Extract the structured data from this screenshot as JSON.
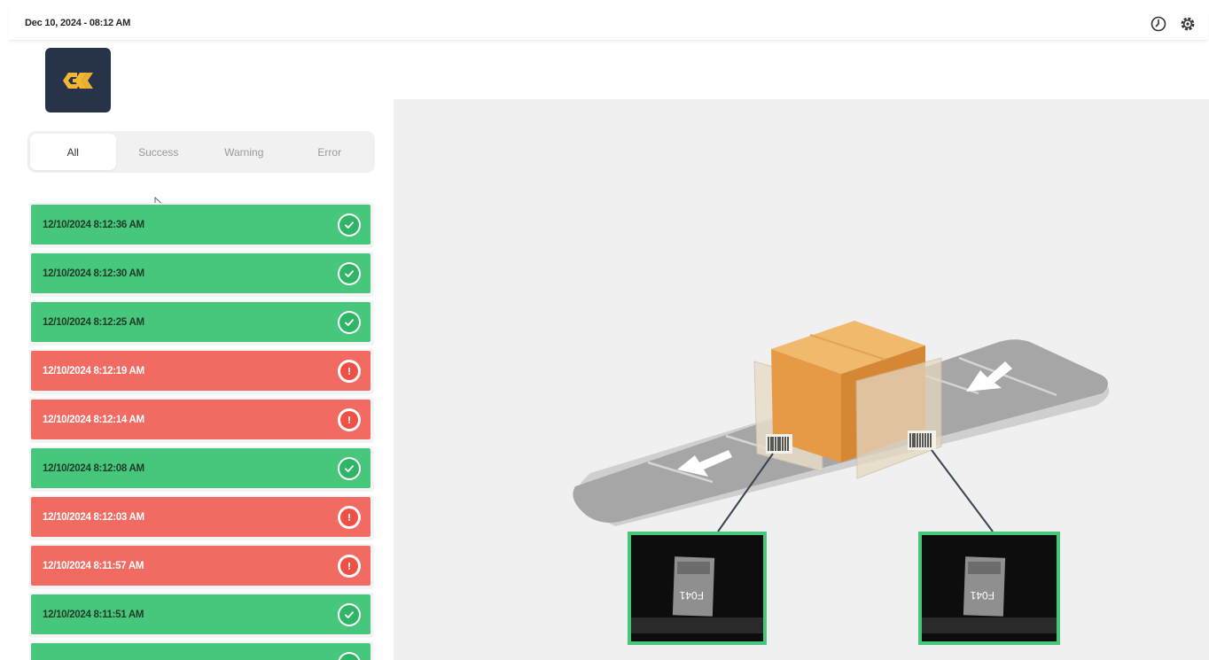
{
  "header": {
    "datetime": "Dec 10, 2024 - 08:12 AM",
    "icons": [
      "history-icon",
      "settings-icon"
    ]
  },
  "logo": {
    "text": "GK",
    "background": "#263349",
    "accent": "#f2b632"
  },
  "filters": {
    "tabs": [
      {
        "label": "All",
        "active": true
      },
      {
        "label": "Success",
        "active": false
      },
      {
        "label": "Warning",
        "active": false
      },
      {
        "label": "Error",
        "active": false
      }
    ]
  },
  "colors": {
    "success": "#46c77b",
    "error": "#f26b62"
  },
  "log": {
    "entries": [
      {
        "timestamp": "12/10/2024 8:12:36 AM",
        "status": "success",
        "icon": "check-circle-icon"
      },
      {
        "timestamp": "12/10/2024 8:12:30 AM",
        "status": "success",
        "icon": "check-circle-icon"
      },
      {
        "timestamp": "12/10/2024 8:12:25 AM",
        "status": "success",
        "icon": "check-circle-icon"
      },
      {
        "timestamp": "12/10/2024 8:12:19 AM",
        "status": "error",
        "icon": "alert-circle-icon"
      },
      {
        "timestamp": "12/10/2024 8:12:14 AM",
        "status": "error",
        "icon": "alert-circle-icon"
      },
      {
        "timestamp": "12/10/2024 8:12:08 AM",
        "status": "success",
        "icon": "check-circle-icon"
      },
      {
        "timestamp": "12/10/2024 8:12:03 AM",
        "status": "error",
        "icon": "alert-circle-icon"
      },
      {
        "timestamp": "12/10/2024 8:11:57 AM",
        "status": "error",
        "icon": "alert-circle-icon"
      },
      {
        "timestamp": "12/10/2024 8:11:51 AM",
        "status": "success",
        "icon": "check-circle-icon"
      },
      {
        "timestamp": "",
        "status": "success",
        "icon": "check-circle-icon"
      }
    ]
  },
  "scene": {
    "camera_feed_left": {
      "label_text": "F041",
      "border": "#46c77b"
    },
    "camera_feed_right": {
      "label_text": "F041",
      "border": "#46c77b"
    }
  }
}
